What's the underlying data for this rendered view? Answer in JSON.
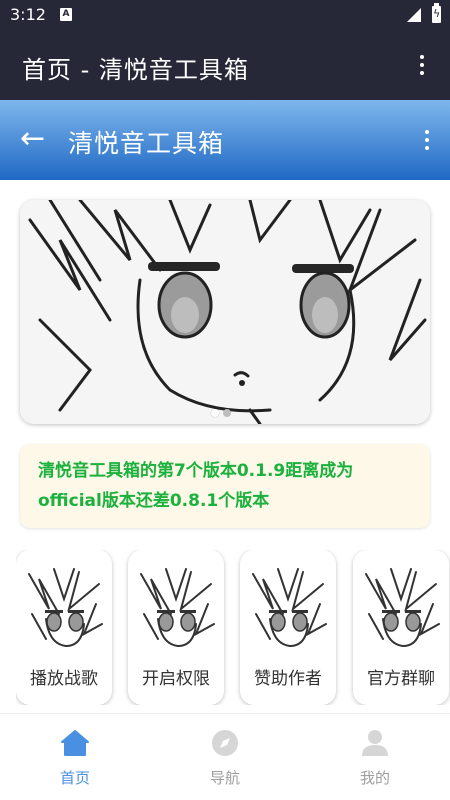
{
  "status_bar": {
    "time": "3:12",
    "notification_icon": "A"
  },
  "app_bar": {
    "title": "首页 - 清悦音工具箱",
    "menu_icon": "more-vert-icon"
  },
  "page_header": {
    "back_icon": "←",
    "title": "清悦音工具箱",
    "menu_icon": "more-vert-icon"
  },
  "banner": {
    "slide_count": 2,
    "active_slide": 1
  },
  "notice": {
    "text": "清悦音工具箱的第7个版本0.1.9距离成为official版本还差0.8.1个版本"
  },
  "features": [
    {
      "label": "播放战歌"
    },
    {
      "label": "开启权限"
    },
    {
      "label": "赞助作者"
    },
    {
      "label": "官方群聊"
    }
  ],
  "bottom_nav": {
    "items": [
      {
        "label": "首页",
        "icon": "home-icon",
        "active": true
      },
      {
        "label": "导航",
        "icon": "compass-icon",
        "active": false
      },
      {
        "label": "我的",
        "icon": "profile-icon",
        "active": false
      }
    ]
  },
  "colors": {
    "status_bar": "#262838",
    "header_gradient_top": "#7fb7ec",
    "header_gradient_bottom": "#1f68c4",
    "notice_text": "#1bb13d",
    "notice_bg": "#fdf8e7",
    "nav_active": "#4a90e2",
    "nav_inactive": "#9e9e9e"
  }
}
